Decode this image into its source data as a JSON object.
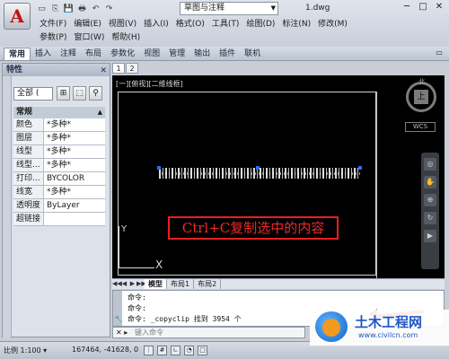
{
  "titlebar": {
    "app_button": "A",
    "workspace": "草图与注释",
    "document": "1.dwg",
    "quick_access": [
      "▭",
      "⎘",
      "💾",
      "🖶",
      "↶",
      "↷"
    ]
  },
  "menu": {
    "row1": [
      "文件(F)",
      "编辑(E)",
      "视图(V)",
      "插入(I)",
      "格式(O)",
      "工具(T)",
      "绘图(D)",
      "标注(N)",
      "修改(M)"
    ],
    "row2": [
      "参数(P)",
      "窗口(W)",
      "帮助(H)"
    ]
  },
  "ribbon": {
    "tabs": [
      "常用",
      "插入",
      "注释",
      "布局",
      "参数化",
      "视图",
      "管理",
      "输出",
      "插件",
      "联机"
    ]
  },
  "properties": {
    "title": "特性",
    "selection": "全部 (",
    "section": "常规",
    "rows": [
      {
        "key": "颜色",
        "value": "*多种*"
      },
      {
        "key": "图层",
        "value": "*多种*"
      },
      {
        "key": "线型",
        "value": "*多种*"
      },
      {
        "key": "线型...",
        "value": "*多种*"
      },
      {
        "key": "打印...",
        "value": "BYCOLOR"
      },
      {
        "key": "线宽",
        "value": "*多种*"
      },
      {
        "key": "透明度",
        "value": "ByLayer"
      },
      {
        "key": "超链接",
        "value": ""
      }
    ]
  },
  "file_tabs": [
    "1",
    "2"
  ],
  "viewport": {
    "label": "[一][俯视][二维线框]",
    "hint": "Ctrl+C复制选中的内容",
    "ucs_x": "X",
    "ucs_y": "Y",
    "compass_center": "上",
    "compass_north": "北",
    "wcs": "WCS"
  },
  "layout_tabs": [
    "模型",
    "布局1",
    "布局2"
  ],
  "command": {
    "line1": "命令:",
    "line2": "命令:",
    "line3": "命令: _copyclip 找到 3954 个",
    "placeholder": "键入命令"
  },
  "status": {
    "scale": "比例 1:100 ▾",
    "coords": "167464, -41628, 0"
  },
  "watermark": {
    "title": "土木工程网",
    "url": "www.civilcn.com"
  },
  "colors": {
    "hint_red": "#e62020",
    "viewport_bg": "#000000",
    "accent_blue": "#1d56c5"
  }
}
